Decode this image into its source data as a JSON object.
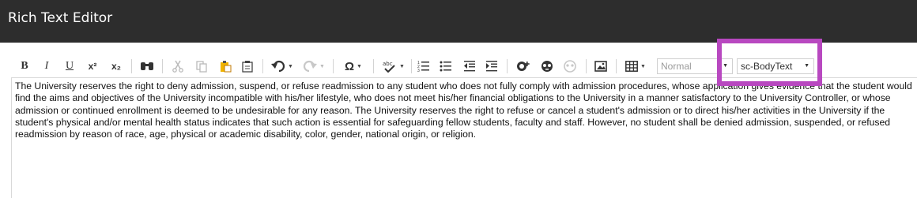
{
  "app": {
    "title": "Rich Text Editor"
  },
  "toolbar": {
    "bold": "B",
    "italic": "I",
    "underline": "U",
    "superscript": "x²",
    "subscript": "x₂",
    "special_char": "Ω",
    "format_select": "Normal",
    "style_select": "sc-BodyText"
  },
  "editor": {
    "text": "The University reserves the right to deny admission, suspend, or refuse readmission to any student who does not fully comply with admission procedures, whose application gives evidence that the student would find the aims and objectives of the University incompatible with his/her lifestyle, who does not meet his/her financial obligations to the University in a manner satisfactory to the University Controller, or whose admission or continued enrollment is deemed to be undesirable for any reason. The University reserves the right to refuse or cancel a student's admission or to direct his/her activities in the University if the student's physical and/or mental health status indicates that such action is essential for safeguarding fellow students, faculty and staff. However, no student shall be denied admission, suspended, or refused readmission by reason of race, age, physical or academic disability, color, gender, national origin, or religion."
  },
  "colors": {
    "header_bg": "#2d2d2d",
    "highlight": "#b848c0"
  }
}
